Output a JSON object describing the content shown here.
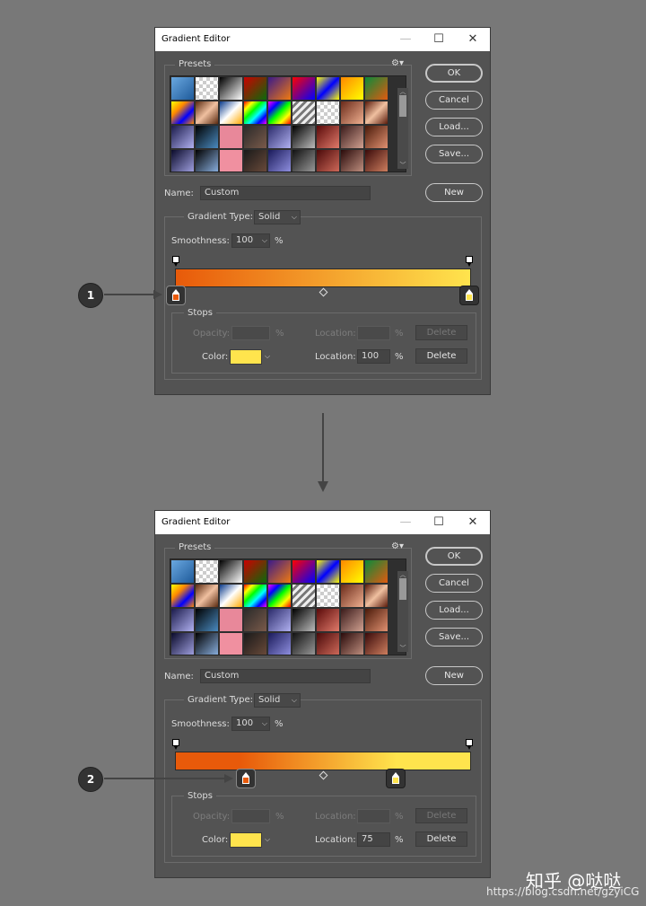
{
  "dialogs": [
    {
      "title": "Gradient Editor",
      "presets_label": "Presets",
      "buttons": {
        "ok": "OK",
        "cancel": "Cancel",
        "load": "Load...",
        "save": "Save...",
        "new": "New"
      },
      "name_label": "Name:",
      "name_value": "Custom",
      "gradient_type_label": "Gradient Type:",
      "gradient_type_value": "Solid",
      "smoothness_label": "Smoothness:",
      "smoothness_value": "100",
      "percent": "%",
      "stops_label": "Stops",
      "opacity_label": "Opacity:",
      "location_label": "Location:",
      "delete_label": "Delete",
      "color_label": "Color:",
      "color_location_value": "100",
      "color_stop_left_location": 0,
      "color_stop_right_location": 100
    },
    {
      "title": "Gradient Editor",
      "presets_label": "Presets",
      "buttons": {
        "ok": "OK",
        "cancel": "Cancel",
        "load": "Load...",
        "save": "Save...",
        "new": "New"
      },
      "name_label": "Name:",
      "name_value": "Custom",
      "gradient_type_label": "Gradient Type:",
      "gradient_type_value": "Solid",
      "smoothness_label": "Smoothness:",
      "smoothness_value": "100",
      "percent": "%",
      "stops_label": "Stops",
      "opacity_label": "Opacity:",
      "location_label": "Location:",
      "delete_label": "Delete",
      "color_label": "Color:",
      "color_location_value": "75",
      "color_stop_left_location": 22,
      "color_stop_right_location": 75
    }
  ],
  "callouts": [
    "1",
    "2"
  ],
  "colors": {
    "gradient_start": "#e85a0a",
    "gradient_end": "#ffe44d",
    "selected_color": "#ffe44d"
  },
  "watermark": {
    "line1": "知乎 @哒哒",
    "line2": "https://blog.csdn.net/gzyiCG"
  }
}
